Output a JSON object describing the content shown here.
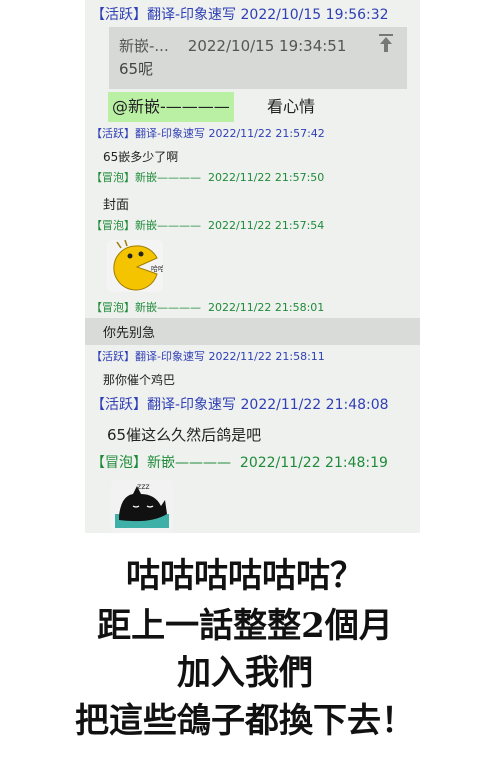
{
  "chat": {
    "m1": {
      "tag": "【活跃】",
      "name": "翻译-印象速写",
      "time": "2022/10/15 19:56:32"
    },
    "quote": {
      "name": "新嵌-...",
      "time": "2022/10/15 19:34:51",
      "text": "65呢"
    },
    "mention": {
      "at": "@新嵌-————",
      "after": "看心情"
    },
    "m2": {
      "tag": "【活跃】",
      "name": "翻译-印象速写",
      "time": "2022/11/22 21:57:42",
      "text": "65嵌多少了啊"
    },
    "m3": {
      "tag": "【冒泡】",
      "name": "新嵌————",
      "time": "2022/11/22 21:57:50",
      "text": "封面"
    },
    "m4": {
      "tag": "【冒泡】",
      "name": "新嵌————",
      "time": "2022/11/22 21:57:54",
      "sticker_text": "哈哈"
    },
    "m5": {
      "tag": "【冒泡】",
      "name": "新嵌————",
      "time": "2022/11/22 21:58:01",
      "text": "你先别急"
    },
    "m6": {
      "tag": "【活跃】",
      "name": "翻译-印象速写",
      "time": "2022/11/22 21:58:11",
      "text": "那你催个鸡巴"
    },
    "m7": {
      "tag": "【活跃】",
      "name": "翻译-印象速写",
      "time": "2022/11/22 21:48:08",
      "text": "65催这么久然后鸽是吧"
    },
    "m8": {
      "tag": "【冒泡】",
      "name": "新嵌————",
      "time": "2022/11/22 21:48:19",
      "sticker_text": "zzz"
    }
  },
  "caption": {
    "line1": "咕咕咕咕咕咕？",
    "line2": "距上一話整整2個月",
    "line3": "加入我們",
    "line4": "把這些鴿子都換下去！"
  },
  "colors": {
    "active": "#2f3fb5",
    "bubble": "#1f8b3a",
    "mention_bg": "#b9f0a4",
    "chat_bg": "#eff1ee"
  }
}
